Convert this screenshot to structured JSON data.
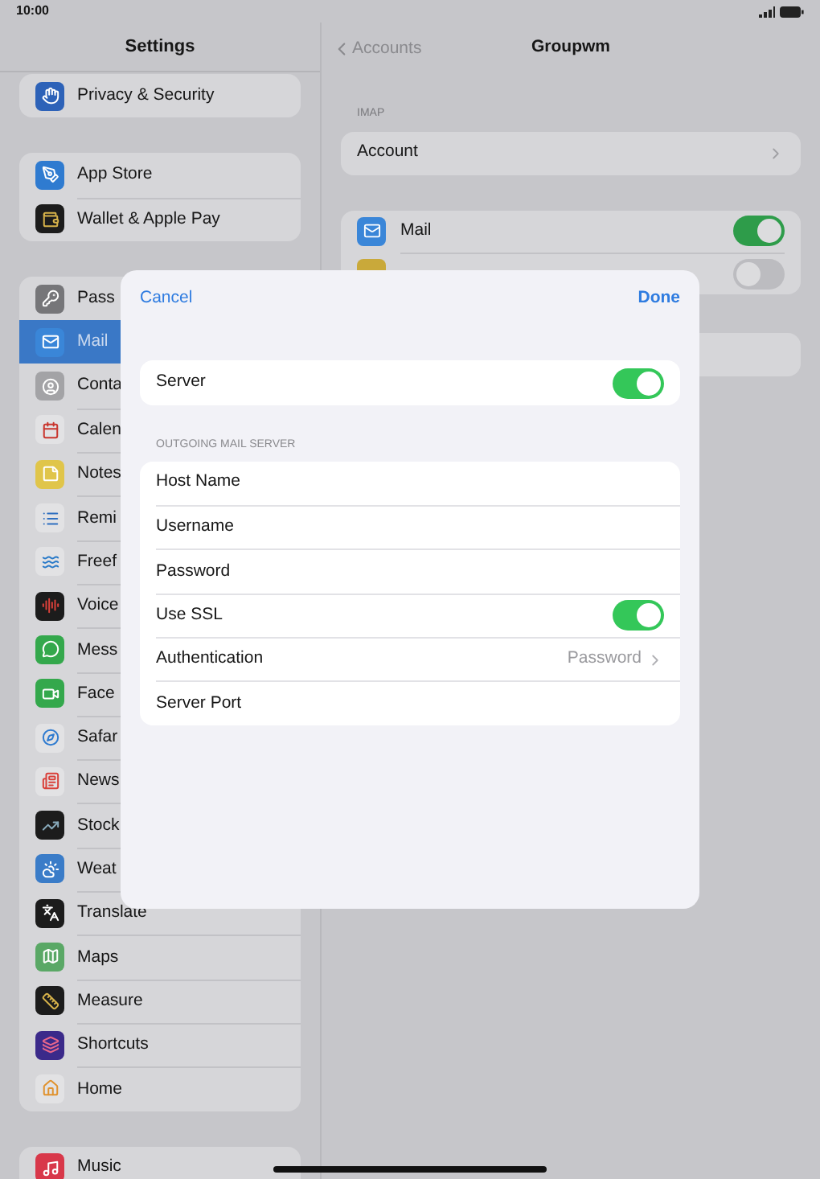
{
  "status_bar": {
    "time": "10:00"
  },
  "sidebar": {
    "title": "Settings",
    "groups": [
      {
        "items": [
          {
            "label": "Privacy & Security",
            "selected": false
          }
        ]
      },
      {
        "items": [
          {
            "label": "App Store",
            "selected": false
          },
          {
            "label": "Wallet & Apple Pay",
            "selected": false
          }
        ]
      },
      {
        "items": [
          {
            "label": "Pass",
            "selected": false
          },
          {
            "label": "Mail",
            "selected": true
          },
          {
            "label": "Conta",
            "selected": false
          },
          {
            "label": "Calen",
            "selected": false
          },
          {
            "label": "Notes",
            "selected": false
          },
          {
            "label": "Remi",
            "selected": false
          },
          {
            "label": "Freef",
            "selected": false
          },
          {
            "label": "Voice",
            "selected": false
          },
          {
            "label": "Mess",
            "selected": false
          },
          {
            "label": "Face",
            "selected": false
          },
          {
            "label": "Safar",
            "selected": false
          },
          {
            "label": "News",
            "selected": false
          },
          {
            "label": "Stock",
            "selected": false
          },
          {
            "label": "Weat",
            "selected": false
          },
          {
            "label": "Translate",
            "selected": false
          },
          {
            "label": "Maps",
            "selected": false
          },
          {
            "label": "Measure",
            "selected": false
          },
          {
            "label": "Shortcuts",
            "selected": false
          },
          {
            "label": "Home",
            "selected": false
          }
        ]
      },
      {
        "items": [
          {
            "label": "Music",
            "selected": false
          }
        ]
      }
    ]
  },
  "detail": {
    "back": "Accounts",
    "title": "Groupwm",
    "section": "IMAP",
    "account_row": "Account",
    "toggles": [
      {
        "label": "Mail",
        "on": true
      },
      {
        "on": false
      }
    ]
  },
  "modal": {
    "cancel": "Cancel",
    "done": "Done",
    "server": {
      "label": "Server",
      "on": true
    },
    "section": "OUTGOING MAIL SERVER",
    "rows": [
      {
        "kind": "text",
        "label": "Host Name"
      },
      {
        "kind": "text",
        "label": "Username"
      },
      {
        "kind": "text",
        "label": "Password"
      },
      {
        "kind": "toggle",
        "label": "Use SSL",
        "on": true
      },
      {
        "kind": "link",
        "label": "Authentication",
        "value": "Password"
      },
      {
        "kind": "text",
        "label": "Server Port"
      }
    ]
  }
}
